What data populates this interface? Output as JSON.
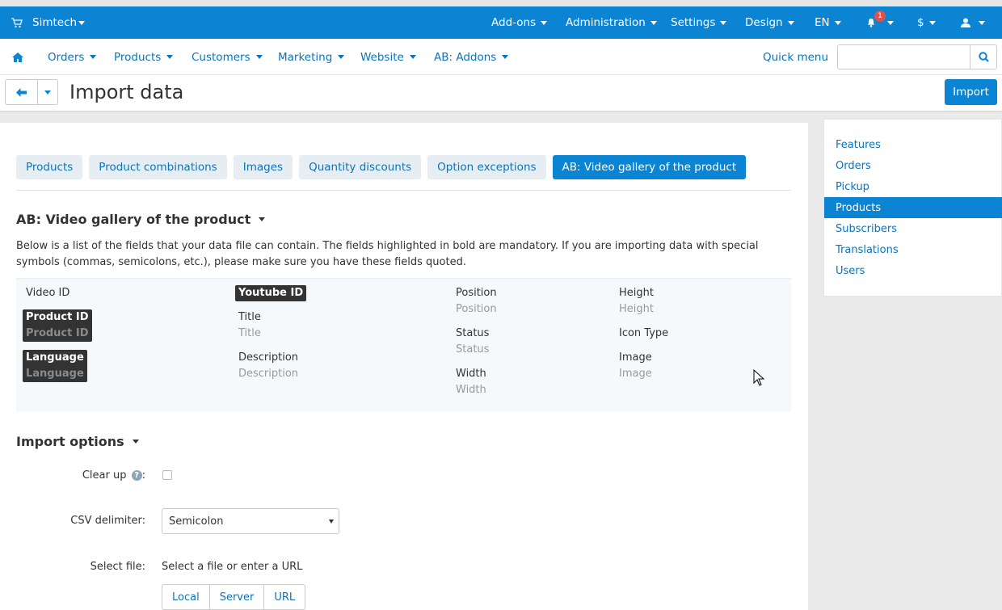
{
  "topbar": {
    "brand": "Simtech",
    "items": [
      "Add-ons",
      "Administration",
      "Settings",
      "Design",
      "EN"
    ],
    "notification_count": "1",
    "currency": "$"
  },
  "menu": {
    "items": [
      "Orders",
      "Products",
      "Customers",
      "Marketing",
      "Website",
      "AB: Addons"
    ],
    "quick_menu": "Quick menu",
    "search_placeholder": ""
  },
  "page": {
    "title": "Import data",
    "import_button": "Import"
  },
  "tabs": [
    "Products",
    "Product combinations",
    "Images",
    "Quantity discounts",
    "Option exceptions",
    "AB: Video gallery of the product"
  ],
  "active_tab": "AB: Video gallery of the product",
  "section": {
    "title": "AB: Video gallery of the product",
    "description": "Below is a list of the fields that your data file can contain. The fields highlighted in bold are mandatory. If you are importing data with special symbols (commas, semicolons, etc.), please make sure you have these fields quoted."
  },
  "fields": {
    "video_id": "Video ID",
    "product_id": {
      "label": "Product ID",
      "sample": "Product ID"
    },
    "language": {
      "label": "Language",
      "sample": "Language"
    },
    "youtube_id": "Youtube ID",
    "title": {
      "label": "Title",
      "sample": "Title"
    },
    "description": {
      "label": "Description",
      "sample": "Description"
    },
    "position": {
      "label": "Position",
      "sample": "Position"
    },
    "status": {
      "label": "Status",
      "sample": "Status"
    },
    "width": {
      "label": "Width",
      "sample": "Width"
    },
    "height": {
      "label": "Height",
      "sample": "Height"
    },
    "icon_type": "Icon Type",
    "image": {
      "label": "Image",
      "sample": "Image"
    }
  },
  "options": {
    "title": "Import options",
    "clear_up": "Clear up",
    "help_glyph": "?",
    "clear_up_suffix": ":",
    "csv_delimiter": "CSV delimiter:",
    "csv_value": "Semicolon",
    "select_file": "Select file:",
    "file_hint": "Select a file or enter a URL",
    "file_buttons": [
      "Local",
      "Server",
      "URL"
    ]
  },
  "sidebar": {
    "items": [
      "Features",
      "Orders",
      "Pickup",
      "Products",
      "Subscribers",
      "Translations",
      "Users"
    ],
    "active": "Products"
  },
  "colors": {
    "primary": "#0b84d3",
    "link": "#0b74b8",
    "tab_bg": "#e6eef3",
    "mandatory_bg": "#333333"
  }
}
